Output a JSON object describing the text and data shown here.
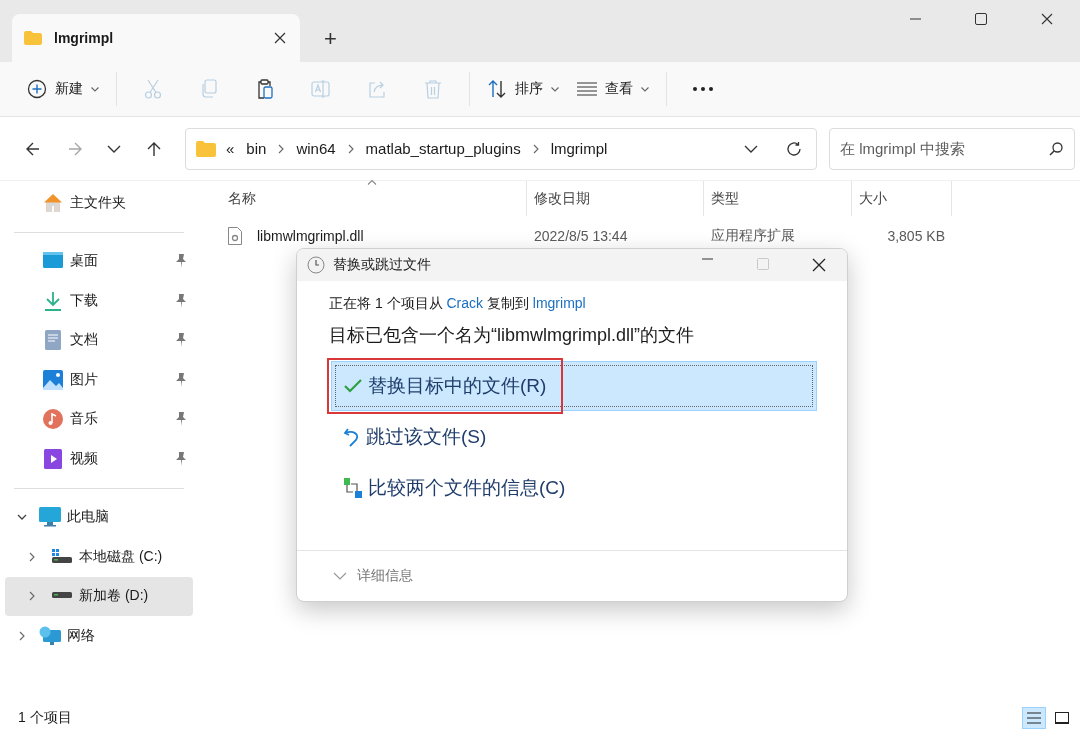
{
  "window": {
    "tab": {
      "title": "lmgrimpl",
      "selected": true
    },
    "new_tab": "+"
  },
  "toolbar": [
    {
      "kind": "new",
      "label": "新建",
      "disabled": false
    },
    {
      "kind": "cut",
      "disabled": true
    },
    {
      "kind": "copy",
      "disabled": true
    },
    {
      "kind": "paste",
      "disabled": false
    },
    {
      "kind": "rename",
      "disabled": true
    },
    {
      "kind": "share",
      "disabled": true
    },
    {
      "kind": "delete",
      "disabled": true
    },
    {
      "kind": "sort",
      "label": "排序",
      "disabled": false
    },
    {
      "kind": "view",
      "label": "查看",
      "disabled": false
    },
    {
      "kind": "more",
      "disabled": false
    }
  ],
  "navigation": [
    {
      "kind": "back",
      "disabled": false
    },
    {
      "kind": "forward",
      "disabled": true
    },
    {
      "kind": "recent",
      "disabled": false
    },
    {
      "kind": "up",
      "disabled": false
    }
  ],
  "address": {
    "overflow": "«",
    "path": [
      "bin",
      "win64",
      "matlab_startup_plugins",
      "lmgrimpl"
    ]
  },
  "search": {
    "placeholder": "在 lmgrimpl 中搜索"
  },
  "sidebar": {
    "home": {
      "label": "主文件夹"
    },
    "quick_access": [
      {
        "label": "桌面",
        "kind": "desktop",
        "pinned": true
      },
      {
        "label": "下载",
        "kind": "downloads",
        "pinned": true
      },
      {
        "label": "文档",
        "kind": "documents",
        "pinned": true
      },
      {
        "label": "图片",
        "kind": "pictures",
        "pinned": true
      },
      {
        "label": "音乐",
        "kind": "music",
        "pinned": true
      },
      {
        "label": "视频",
        "kind": "videos",
        "pinned": true
      }
    ],
    "tree": [
      {
        "label": "此电脑",
        "kind": "pc",
        "expanded": true,
        "selected": false,
        "children": [
          {
            "label": "本地磁盘 (C:)",
            "kind": "system-drive",
            "expanded": false,
            "selected": false
          },
          {
            "label": "新加卷 (D:)",
            "kind": "drive",
            "expanded": false,
            "selected": true
          }
        ]
      },
      {
        "label": "网络",
        "kind": "network",
        "expanded": false,
        "selected": false
      }
    ]
  },
  "file_list": {
    "columns": [
      {
        "label": "名称",
        "sorted": true
      },
      {
        "label": "修改日期",
        "sorted": false
      },
      {
        "label": "类型",
        "sorted": false
      },
      {
        "label": "大小",
        "sorted": false
      }
    ],
    "rows": [
      {
        "name": "libmwlmgrimpl.dll",
        "modified": "2022/8/5 13:44",
        "type": "应用程序扩展",
        "size": "3,805 KB"
      }
    ]
  },
  "dialog": {
    "title": "替换或跳过文件",
    "maximize_disabled": true,
    "message": {
      "prefix": "正在将 1 个项目从",
      "source": "Crack",
      "middle": "复制到",
      "target": "lmgrimpl"
    },
    "heading": "目标已包含一个名为“libmwlmgrimpl.dll”的文件",
    "options": [
      {
        "kind": "replace",
        "label": "替换目标中的文件(R)",
        "selected": true,
        "highlighted": true
      },
      {
        "kind": "skip",
        "label": "跳过该文件(S)",
        "selected": false,
        "highlighted": false
      },
      {
        "kind": "compare",
        "label": "比较两个文件的信息(C)",
        "selected": false,
        "highlighted": false
      }
    ],
    "details": {
      "label": "详细信息",
      "expanded": false
    }
  },
  "status_bar": {
    "text": "1 个项目",
    "views": [
      {
        "kind": "details",
        "selected": true
      },
      {
        "kind": "tiles",
        "selected": false
      }
    ]
  }
}
